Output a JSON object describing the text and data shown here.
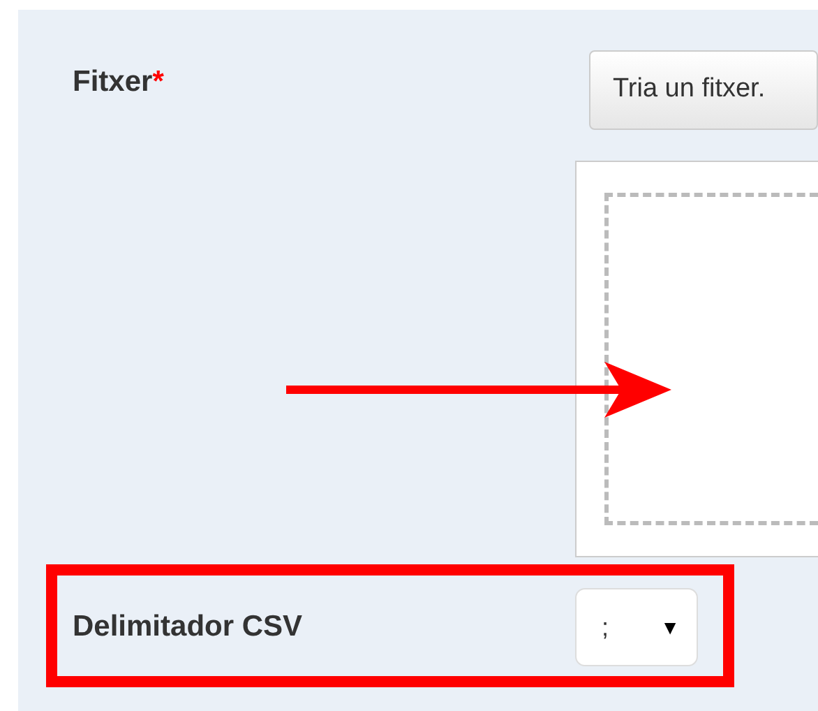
{
  "file_field": {
    "label": "Fitxer",
    "required_mark": "*",
    "button": "Tria un fitxer."
  },
  "csv_delimiter": {
    "label": "Delimitador CSV",
    "value": ";",
    "caret": "▼"
  }
}
